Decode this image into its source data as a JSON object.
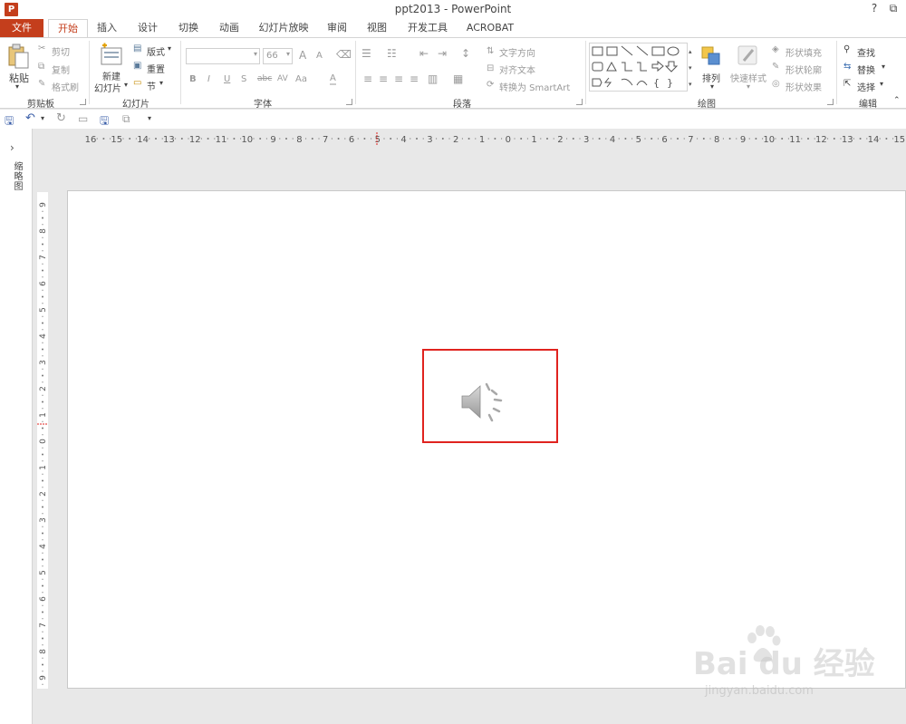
{
  "window": {
    "title": "ppt2013 - PowerPoint",
    "app_icon": "P",
    "help": "?",
    "ribbon_toggle": "⧉"
  },
  "tabs": [
    {
      "label": "文件"
    },
    {
      "label": "开始"
    },
    {
      "label": "插入"
    },
    {
      "label": "设计"
    },
    {
      "label": "切换"
    },
    {
      "label": "动画"
    },
    {
      "label": "幻灯片放映"
    },
    {
      "label": "审阅"
    },
    {
      "label": "视图"
    },
    {
      "label": "开发工具"
    },
    {
      "label": "ACROBAT"
    }
  ],
  "ribbon": {
    "clipboard": {
      "label": "剪贴板",
      "paste": "粘贴",
      "cut": "剪切",
      "copy": "复制",
      "format_painter": "格式刷"
    },
    "slides": {
      "label": "幻灯片",
      "new_slide_1": "新建",
      "new_slide_2": "幻灯片",
      "layout": "版式",
      "reset": "重置",
      "section": "节"
    },
    "font": {
      "label": "字体",
      "font_name": "",
      "font_size": "66",
      "bold": "B",
      "italic": "I",
      "underline": "U",
      "shadow": "S",
      "strike": "abc",
      "spacing": "AV",
      "case": "Aa",
      "color": "A",
      "grow": "A",
      "shrink": "A"
    },
    "paragraph": {
      "label": "段落",
      "text_direction": "文字方向",
      "align_text": "对齐文本",
      "smartart": "转换为 SmartArt"
    },
    "drawing": {
      "label": "绘图",
      "arrange": "排列",
      "quick_styles": "快速样式",
      "shape_fill": "形状填充",
      "shape_outline": "形状轮廓",
      "shape_effects": "形状效果"
    },
    "editing": {
      "label": "编辑",
      "find": "查找",
      "replace": "替换",
      "select": "选择"
    }
  },
  "left_pane": {
    "label": "缩略图"
  },
  "rulers": {
    "horizontal": [
      "16",
      "15",
      "14",
      "13",
      "12",
      "11",
      "10",
      "9",
      "8",
      "7",
      "6",
      "5",
      "4",
      "3",
      "2",
      "1",
      "0",
      "1",
      "2",
      "3",
      "4",
      "5",
      "6",
      "7",
      "8",
      "9",
      "10",
      "11",
      "12",
      "13",
      "14",
      "15"
    ],
    "vertical": [
      "9",
      "8",
      "7",
      "6",
      "5",
      "4",
      "3",
      "2",
      "1",
      "0",
      "1",
      "2",
      "3",
      "4",
      "5",
      "6",
      "7",
      "8",
      "9"
    ]
  },
  "watermark": {
    "brand": "Bai du 经验",
    "url": "jingyan.baidu.com"
  },
  "colors": {
    "accent": "#c43e1c",
    "highlight": "#e0231f"
  }
}
